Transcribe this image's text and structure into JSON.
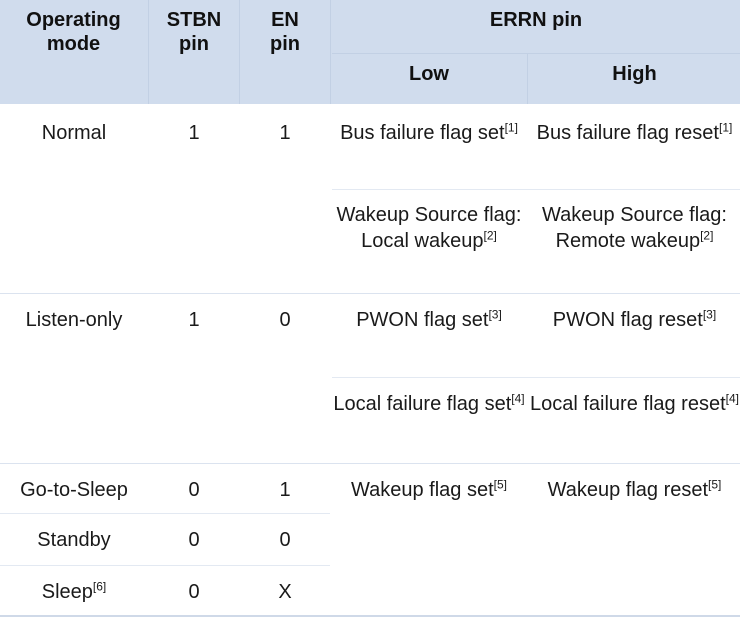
{
  "table": {
    "header": {
      "operating_mode": "Operating\nmode",
      "operating_mode_line1": "Operating",
      "operating_mode_line2": "mode",
      "stbn_line1": "STBN",
      "stbn_line2": "pin",
      "en_line1": "EN",
      "en_line2": "pin",
      "errn_pin": "ERRN pin",
      "low": "Low",
      "high": "High"
    },
    "colors": {
      "header_background": "#d0dced",
      "header_divider": "#c2d0e4",
      "row_rule": "#e3e9f2",
      "bottom_border": "#cfd9e8",
      "text": "#1a1a1a"
    },
    "rows": [
      {
        "mode": "Normal",
        "stbn": "1",
        "en": "1",
        "low": "Bus failure flag set",
        "low_note": "[1]",
        "high": "Bus failure flag reset",
        "high_note": "[1]"
      },
      {
        "mode": "",
        "stbn": "",
        "en": "",
        "low": "Wakeup Source flag:  Local wakeup",
        "low_note": "[2]",
        "high": "Wakeup Source flag: Remote wakeup",
        "high_note": "[2]"
      },
      {
        "mode": "Listen-only",
        "stbn": "1",
        "en": "0",
        "low": "PWON flag set",
        "low_note": "[3]",
        "high": "PWON flag reset",
        "high_note": "[3]"
      },
      {
        "mode": "",
        "stbn": "",
        "en": "",
        "low": "Local failure flag set",
        "low_note": "[4]",
        "high": "Local failure flag reset",
        "high_note": "[4]"
      },
      {
        "mode": "Go-to-Sleep",
        "stbn": "0",
        "en": "1",
        "low": "Wakeup flag set",
        "low_note": "[5]",
        "high": "Wakeup flag reset",
        "high_note": "[5]"
      },
      {
        "mode": "Standby",
        "stbn": "0",
        "en": "0",
        "low": "",
        "low_note": "",
        "high": "",
        "high_note": ""
      },
      {
        "mode": "Sleep",
        "mode_note": "[6]",
        "stbn": "0",
        "en": "X",
        "low": "",
        "low_note": "",
        "high": "",
        "high_note": ""
      }
    ]
  }
}
